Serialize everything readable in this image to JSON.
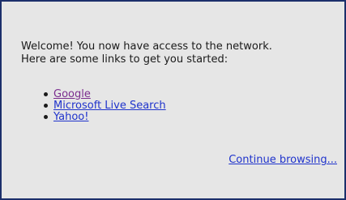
{
  "message": {
    "line1": "Welcome! You now have access to the network.",
    "line2": "Here are some links to get you started:"
  },
  "links": [
    {
      "label": "Google",
      "visited": true
    },
    {
      "label": "Microsoft Live Search",
      "visited": false
    },
    {
      "label": "Yahoo!",
      "visited": false
    }
  ],
  "continue_label": "Continue browsing...",
  "colors": {
    "border": "#1c2f6b",
    "background": "#e6e6e6",
    "link": "#1f33cc",
    "visited_link": "#7b2d8e"
  }
}
